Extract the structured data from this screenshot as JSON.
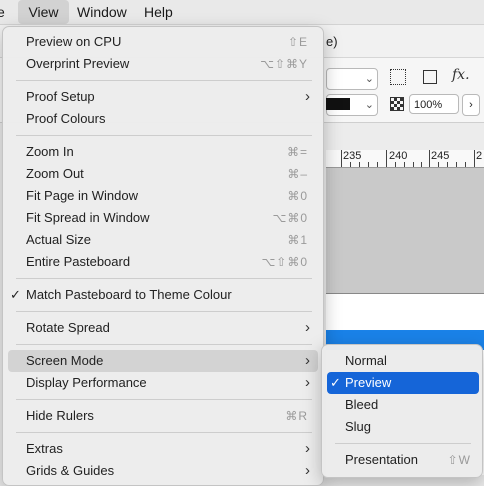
{
  "menubar": {
    "edit": "e",
    "view": "View",
    "window": "Window",
    "help": "Help"
  },
  "document": {
    "title_fragment": "e)"
  },
  "control_panel": {
    "opacity_value": "100%",
    "fx_label": "fx."
  },
  "ruler": {
    "ticks": [
      "235",
      "240",
      "245",
      "2"
    ]
  },
  "view_menu": {
    "items": [
      {
        "label": "Preview on CPU",
        "shortcut": "⇧E"
      },
      {
        "label": "Overprint Preview",
        "shortcut": "⌥⇧⌘Y"
      },
      {
        "label": "Proof Setup",
        "submenu": true
      },
      {
        "label": "Proof Colours"
      },
      {
        "label": "Zoom In",
        "shortcut": "⌘="
      },
      {
        "label": "Zoom Out",
        "shortcut": "⌘–"
      },
      {
        "label": "Fit Page in Window",
        "shortcut": "⌘0"
      },
      {
        "label": "Fit Spread in Window",
        "shortcut": "⌥⌘0"
      },
      {
        "label": "Actual Size",
        "shortcut": "⌘1"
      },
      {
        "label": "Entire Pasteboard",
        "shortcut": "⌥⇧⌘0"
      },
      {
        "label": "Match Pasteboard to Theme Colour",
        "checked": true
      },
      {
        "label": "Rotate Spread",
        "submenu": true
      },
      {
        "label": "Screen Mode",
        "submenu": true,
        "highlighted": true
      },
      {
        "label": "Display Performance",
        "submenu": true
      },
      {
        "label": "Hide Rulers",
        "shortcut": "⌘R"
      },
      {
        "label": "Extras",
        "submenu": true
      },
      {
        "label": "Grids & Guides",
        "submenu": true
      }
    ]
  },
  "screen_mode_submenu": {
    "items": [
      {
        "label": "Normal"
      },
      {
        "label": "Preview",
        "checked": true,
        "selected": true
      },
      {
        "label": "Bleed"
      },
      {
        "label": "Slug"
      },
      {
        "label": "Presentation",
        "shortcut": "⇧W"
      }
    ]
  },
  "colors": {
    "selection": "#1565d8",
    "menu_highlight": "#d3d3d3",
    "blue_strip": "#1a82e8"
  }
}
